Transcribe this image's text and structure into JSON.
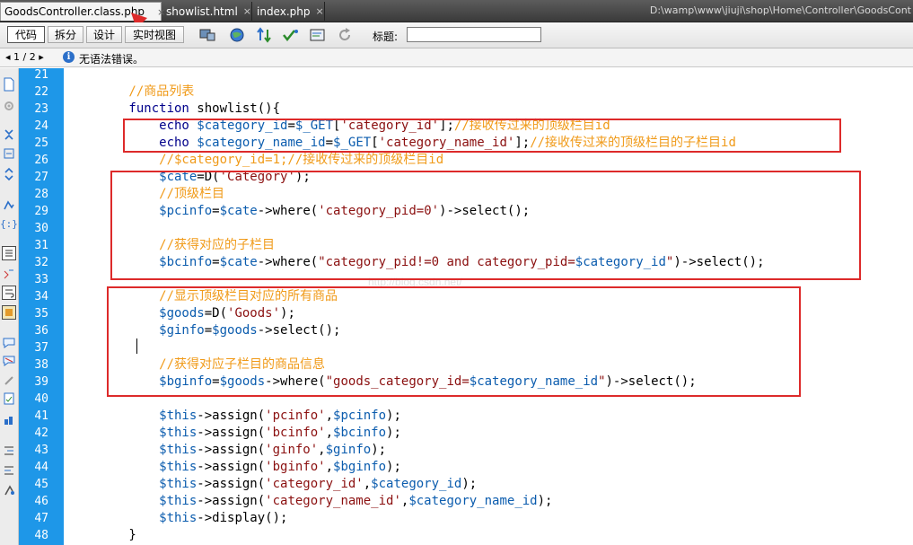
{
  "tabs": [
    {
      "label": "GoodsController.class.php",
      "active": true
    },
    {
      "label": "showlist.html",
      "active": false
    },
    {
      "label": "index.php",
      "active": false
    }
  ],
  "tab_close_glyph": "×",
  "path": "D:\\wamp\\www\\jiuji\\shop\\Home\\Controller\\GoodsCont",
  "toolbar": {
    "views": [
      "代码",
      "拆分",
      "设计",
      "实时视图"
    ],
    "title_label": "标题:",
    "title_value": "",
    "icons": [
      "multiscreen-icon",
      "globe-icon",
      "file-transfer-icon",
      "validate-icon",
      "check-browser-icon",
      "refresh-icon"
    ]
  },
  "status": {
    "pager": "◂ 1 / 2 ▸",
    "message": "无语法错误。"
  },
  "sidebar_icons": [
    "open-documents-icon",
    "gear-icon",
    "expand-tag-icon",
    "collapse-selection-icon",
    "expand-all-icon",
    "select-parent-tag-icon",
    "balance-braces-icon",
    "line-numbers-icon",
    "highlight-invalid-icon",
    "word-wrap-icon",
    "syntax-coloring-icon",
    "apply-comment-icon",
    "remove-comment-icon",
    "wrap-tag-icon",
    "recent-snippets-icon",
    "move-css-icon",
    "indent-icon",
    "outdent-icon",
    "format-source-icon"
  ],
  "colors": {
    "gutter": "#1e97e8",
    "keyword": "#00008b",
    "variable": "#0b5cae",
    "string": "#8b1010",
    "comment": "#f09a18",
    "highlight_box": "#dd2a2a"
  },
  "code_lines": [
    {
      "n": "21",
      "segs": []
    },
    {
      "n": "22",
      "segs": [
        [
          "cmt",
          "        //商品列表"
        ]
      ]
    },
    {
      "n": "23",
      "segs": [
        [
          "kw",
          "        function "
        ],
        [
          "plain",
          "showlist(){"
        ]
      ]
    },
    {
      "n": "24",
      "segs": [
        [
          "kw",
          "            echo "
        ],
        [
          "var",
          "$category_id"
        ],
        [
          "plain",
          "="
        ],
        [
          "var",
          "$_GET"
        ],
        [
          "plain",
          "["
        ],
        [
          "str",
          "'category_id'"
        ],
        [
          "plain",
          "];"
        ],
        [
          "cmt",
          "//接收传过来的顶级栏目id"
        ]
      ]
    },
    {
      "n": "25",
      "segs": [
        [
          "kw",
          "            echo "
        ],
        [
          "var",
          "$category_name_id"
        ],
        [
          "plain",
          "="
        ],
        [
          "var",
          "$_GET"
        ],
        [
          "plain",
          "["
        ],
        [
          "str",
          "'category_name_id'"
        ],
        [
          "plain",
          "];"
        ],
        [
          "cmt",
          "//接收传过来的顶级栏目的子栏目id"
        ]
      ]
    },
    {
      "n": "26",
      "segs": [
        [
          "cmt",
          "            //$category_id=1;//接收传过来的顶级栏目id"
        ]
      ]
    },
    {
      "n": "27",
      "segs": [
        [
          "var",
          "            $cate"
        ],
        [
          "plain",
          "=D("
        ],
        [
          "str",
          "'Category'"
        ],
        [
          "plain",
          ");"
        ]
      ]
    },
    {
      "n": "28",
      "segs": [
        [
          "cmt",
          "            //顶级栏目"
        ]
      ]
    },
    {
      "n": "29",
      "segs": [
        [
          "var",
          "            $pcinfo"
        ],
        [
          "plain",
          "="
        ],
        [
          "var",
          "$cate"
        ],
        [
          "plain",
          "->where("
        ],
        [
          "str",
          "'category_pid=0'"
        ],
        [
          "plain",
          ")->select();"
        ]
      ]
    },
    {
      "n": "30",
      "segs": []
    },
    {
      "n": "31",
      "segs": [
        [
          "cmt",
          "            //获得对应的子栏目"
        ]
      ]
    },
    {
      "n": "32",
      "segs": [
        [
          "var",
          "            $bcinfo"
        ],
        [
          "plain",
          "="
        ],
        [
          "var",
          "$cate"
        ],
        [
          "plain",
          "->where("
        ],
        [
          "str",
          "\"category_pid!=0 and category_pid="
        ],
        [
          "var",
          "$category_id"
        ],
        [
          "str",
          "\""
        ],
        [
          "plain",
          ")->select();"
        ]
      ]
    },
    {
      "n": "33",
      "segs": []
    },
    {
      "n": "34",
      "segs": [
        [
          "cmt",
          "            //显示顶级栏目对应的所有商品"
        ]
      ]
    },
    {
      "n": "35",
      "segs": [
        [
          "var",
          "            $goods"
        ],
        [
          "plain",
          "=D("
        ],
        [
          "str",
          "'Goods'"
        ],
        [
          "plain",
          ");"
        ]
      ]
    },
    {
      "n": "36",
      "segs": [
        [
          "var",
          "            $ginfo"
        ],
        [
          "plain",
          "="
        ],
        [
          "var",
          "$goods"
        ],
        [
          "plain",
          "->select();"
        ]
      ]
    },
    {
      "n": "37",
      "segs": []
    },
    {
      "n": "38",
      "segs": [
        [
          "cmt",
          "            //获得对应子栏目的商品信息"
        ]
      ]
    },
    {
      "n": "39",
      "segs": [
        [
          "var",
          "            $bginfo"
        ],
        [
          "plain",
          "="
        ],
        [
          "var",
          "$goods"
        ],
        [
          "plain",
          "->where("
        ],
        [
          "str",
          "\"goods_category_id="
        ],
        [
          "var",
          "$category_name_id"
        ],
        [
          "str",
          "\""
        ],
        [
          "plain",
          ")->select();"
        ]
      ]
    },
    {
      "n": "40",
      "segs": []
    },
    {
      "n": "41",
      "segs": [
        [
          "var",
          "            $this"
        ],
        [
          "plain",
          "->assign("
        ],
        [
          "str",
          "'pcinfo'"
        ],
        [
          "plain",
          ","
        ],
        [
          "var",
          "$pcinfo"
        ],
        [
          "plain",
          ");"
        ]
      ]
    },
    {
      "n": "42",
      "segs": [
        [
          "var",
          "            $this"
        ],
        [
          "plain",
          "->assign("
        ],
        [
          "str",
          "'bcinfo'"
        ],
        [
          "plain",
          ","
        ],
        [
          "var",
          "$bcinfo"
        ],
        [
          "plain",
          ");"
        ]
      ]
    },
    {
      "n": "43",
      "segs": [
        [
          "var",
          "            $this"
        ],
        [
          "plain",
          "->assign("
        ],
        [
          "str",
          "'ginfo'"
        ],
        [
          "plain",
          ","
        ],
        [
          "var",
          "$ginfo"
        ],
        [
          "plain",
          ");"
        ]
      ]
    },
    {
      "n": "44",
      "segs": [
        [
          "var",
          "            $this"
        ],
        [
          "plain",
          "->assign("
        ],
        [
          "str",
          "'bginfo'"
        ],
        [
          "plain",
          ","
        ],
        [
          "var",
          "$bginfo"
        ],
        [
          "plain",
          ");"
        ]
      ]
    },
    {
      "n": "45",
      "segs": [
        [
          "var",
          "            $this"
        ],
        [
          "plain",
          "->assign("
        ],
        [
          "str",
          "'category_id'"
        ],
        [
          "plain",
          ","
        ],
        [
          "var",
          "$category_id"
        ],
        [
          "plain",
          ");"
        ]
      ]
    },
    {
      "n": "46",
      "segs": [
        [
          "var",
          "            $this"
        ],
        [
          "plain",
          "->assign("
        ],
        [
          "str",
          "'category_name_id'"
        ],
        [
          "plain",
          ","
        ],
        [
          "var",
          "$category_name_id"
        ],
        [
          "plain",
          ");"
        ]
      ]
    },
    {
      "n": "47",
      "segs": [
        [
          "var",
          "            $this"
        ],
        [
          "plain",
          "->display();"
        ]
      ]
    },
    {
      "n": "48",
      "segs": [
        [
          "plain",
          "        }"
        ]
      ]
    }
  ],
  "watermark": "http://blog.csdn.net/"
}
